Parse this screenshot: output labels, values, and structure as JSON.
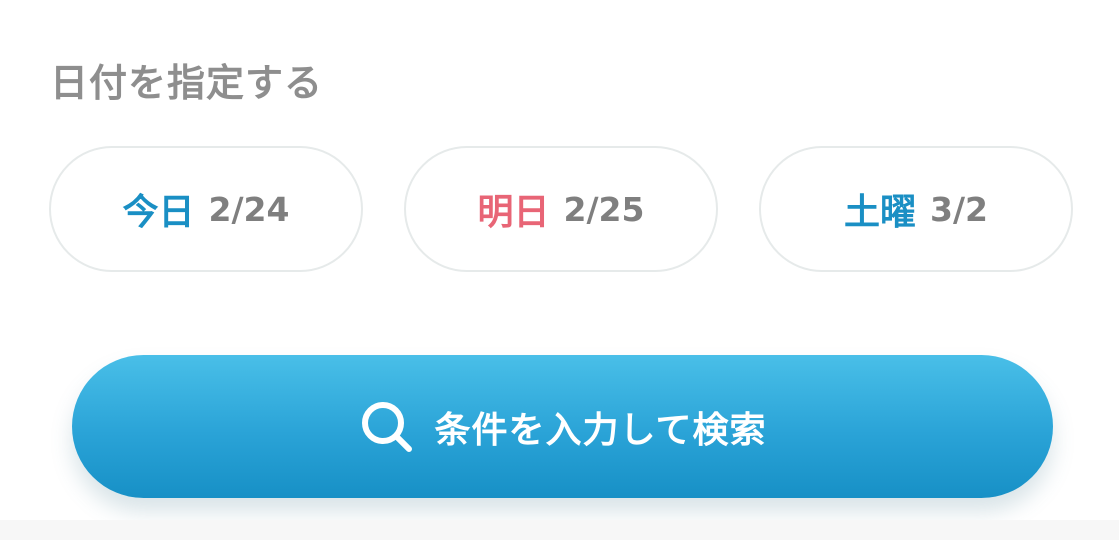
{
  "section": {
    "label": "日付を指定する"
  },
  "dates": [
    {
      "day": "今日",
      "date": "2/24",
      "day_color": "#1a8fc4"
    },
    {
      "day": "明日",
      "date": "2/25",
      "day_color": "#e86576"
    },
    {
      "day": "土曜",
      "date": "3/2",
      "day_color": "#1a8fc4"
    }
  ],
  "search": {
    "label": "条件を入力して検索",
    "icon": "search-icon",
    "gradient": [
      "#49bfe8",
      "#1790c6"
    ]
  }
}
